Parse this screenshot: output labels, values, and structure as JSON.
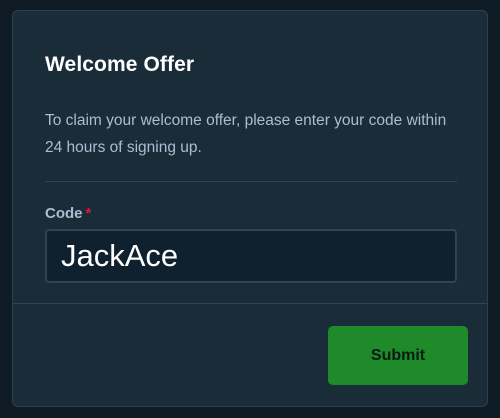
{
  "dialog": {
    "title": "Welcome Offer",
    "description": "To claim your welcome offer, please enter your code within 24 hours of signing up."
  },
  "form": {
    "code_label": "Code",
    "required_marker": "*",
    "code_value": "JackAce"
  },
  "actions": {
    "submit_label": "Submit"
  },
  "colors": {
    "background": "#1a2c38",
    "submit_button": "#1f8a2a",
    "required_marker": "#e9113c"
  }
}
